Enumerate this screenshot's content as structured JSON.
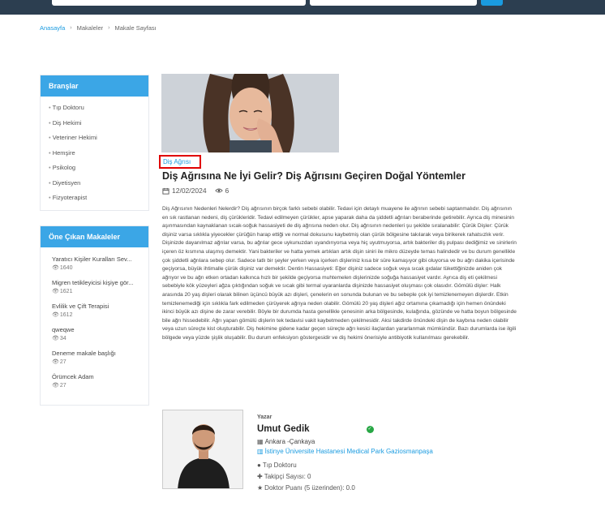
{
  "breadcrumb": {
    "home": "Anasayfa",
    "articles": "Makaleler",
    "current": "Makale Sayfası"
  },
  "branches": {
    "title": "Branşlar",
    "items": [
      "Tıp Doktoru",
      "Diş Hekimi",
      "Veteriner Hekimi",
      "Hemşire",
      "Psikolog",
      "Diyetisyen",
      "Fizyoterapist"
    ]
  },
  "featured": {
    "title": "Öne Çıkan Makaleler",
    "items": [
      {
        "title": "Yaratıcı Kişiler Kuralları Sev...",
        "views": "1640"
      },
      {
        "title": "Migren tetikleyicisi kişiye gör...",
        "views": "1621"
      },
      {
        "title": "Evlilik ve Çift Terapisi",
        "views": "1612"
      },
      {
        "title": "qweqwe",
        "views": "34"
      },
      {
        "title": "Deneme makale başlığı",
        "views": "27"
      },
      {
        "title": "Örümcek Adam",
        "views": "27"
      }
    ]
  },
  "article": {
    "category": "Diş Ağrısı",
    "title": "Diş Ağrısına Ne İyi Gelir? Diş Ağrısını Geçiren Doğal Yöntemler",
    "date": "12/02/2024",
    "views": "6",
    "body": "Diş Ağrısının Nedenleri Nelerdir? Diş ağrısının birçok farklı sebebi olabilir. Tedavi için detaylı muayene ile ağrının sebebi saptanmalıdır. Diş ağrısının en sık rastlanan nedeni, diş çürükleridir. Tedavi edilmeyen çürükler, apse yaparak daha da şiddetli ağrıları beraberinde getirebilir. Ayrıca diş minesinin aşınmasından kaynaklanan sıcak-soğuk hassasiyeti de diş ağrısına neden olur. Diş ağrısının nedenleri şu şekilde sıralanabilir: Çürük Dişler: Çürük dişiniz varsa sıklıkla yiyecekler çürüğün harap ettiği ve normal dokusunu kaybetmiş olan çürük bölgesine takılarak veya birikerek rahatsızlık verir. Dişinizde dayanılmaz ağrılar varsa, bu ağrılar gece uykunuzdan uyandırıyorsa veya hiç uyutmuyorsa, artık bakteriler diş pulpası dediğimiz ve sinirlerin içeren öz kısmına ulaşmış demektir. Yani bakteriler ve hatta yemek artıkları artık dişin siniri ile mikro düzeyde temas halindedir ve bu durum genellikle çok şiddetli ağrılara sebep olur. Sadece tatlı bir şeyler yerken veya içerken dişleriniz kısa bir süre kamaşıyor gibi oluyorsa ve bu ağrı dakika içerisinde geçiyorsa, büyük ihtimalle çürük dişiniz var demektir. Dentin Hassasiyeti: Eğer dişiniz sadece soğuk veya sıcak gıdalar tükettiğinizde aniden çok ağrıyor ve bu ağrı etken ortadan kalkınca hızlı bir şekilde geçiyorsa muhtemelen dişlerinizde soğuğa hassasiyet vardır. Ayrıca diş eti çekilmesi sebebiyle kök yüzeyleri ağza çıktığından soğuk ve sıcak gibi termal uyaranlarda dişinizde hassasiyet oluşması çok olasıdır. Gömülü dişler: Halk arasında 20 yaş dişleri olarak bilinen üçüncü büyük azı dişleri, çenelerin en sonunda bulunan ve bu sebeple çok iyi temizlenemeyen dişlerdir. Etkin temizlenemediği için sıklıkla fark edilmeden çürüyerek ağrıya neden olabilir. Gömülü 20 yaş dişleri ağız ortamına çıkamadığı için hemen önündeki ikinci büyük azı dişine de zarar verebilir. Böyle bir durumda hasta genellikle çenesinin arka bölgesinde, kulağında, gözünde ve hatta boyun bölgesinde bile ağrı hissedebilir. Ağrı yapan gömülü dişlerin tek tedavisi vakit kaybetmeden çekilmesidir. Aksi takdirde önündeki dişin de kaybına neden olabilir veya uzun süreçte kist oluşturabilir. Diş hekimine gidene kadar geçen süreçte ağrı kesici ilaçlardan yararlanmak mümkündür. Bazı durumlarda ise ilgili bölgede veya yüzde şişlik oluşabilir. Bu durum enfeksiyon göstergesidir ve diş hekimi önerisiyle antibiyotik kullanılması gerekebilir."
  },
  "author": {
    "label": "Yazar",
    "name": "Umut Gedik",
    "location": "Ankara -Çankaya",
    "hospital": "İstinye Üniversite Hastanesi Medical Park Gaziosmanpaşa",
    "profession": "Tıp Doktoru",
    "followers": "Takipçi Sayısı: 0",
    "rating": "Doktor Puanı (5 üzerinden): 0.0"
  },
  "colors": {
    "accent": "#1a9be0",
    "panel_header": "#3ba6e6",
    "topbar": "#2c3e50",
    "highlight": "#e00000",
    "verified": "#28a745"
  }
}
